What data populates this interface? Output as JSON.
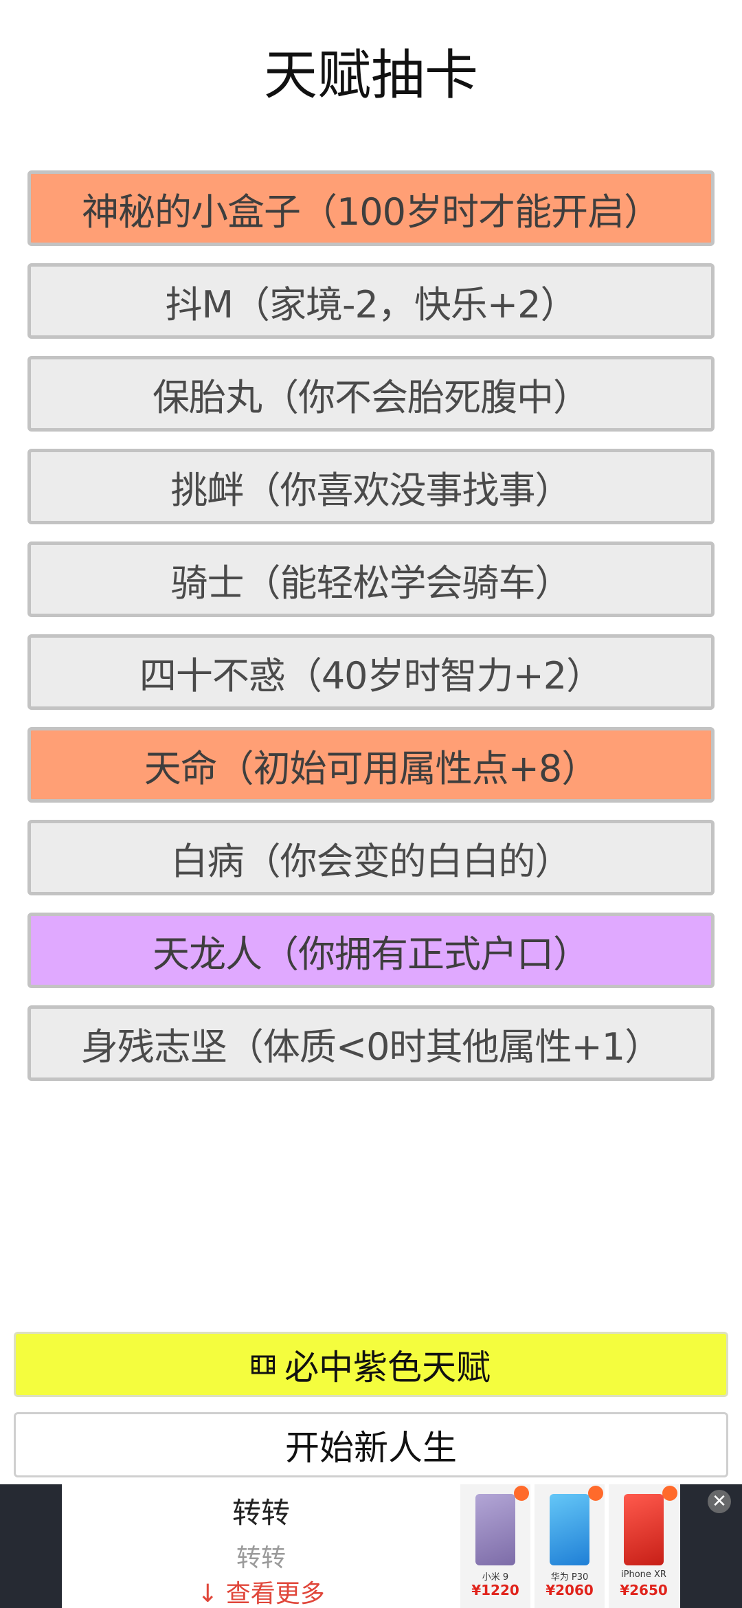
{
  "title": "天赋抽卡",
  "talents": [
    {
      "label": "神秘的小盒子（100岁时才能开启）",
      "color": "#ff9f75"
    },
    {
      "label": "抖M（家境-2，快乐+2）",
      "color": "#ececec"
    },
    {
      "label": "保胎丸（你不会胎死腹中）",
      "color": "#ececec"
    },
    {
      "label": "挑衅（你喜欢没事找事）",
      "color": "#ececec"
    },
    {
      "label": "骑士（能轻松学会骑车）",
      "color": "#ececec"
    },
    {
      "label": "四十不惑（40岁时智力+2）",
      "color": "#ececec"
    },
    {
      "label": "天命（初始可用属性点+8）",
      "color": "#ff9f75"
    },
    {
      "label": "白病（你会变的白白的）",
      "color": "#ececec"
    },
    {
      "label": "天龙人（你拥有正式户口）",
      "color": "#e0a9ff"
    },
    {
      "label": "身残志坚（体质<0时其他属性+1）",
      "color": "#ececec"
    }
  ],
  "buttons": {
    "guarantee_purple": "必中紫色天赋",
    "guarantee_icon": "film-icon",
    "start_new_life": "开始新人生"
  },
  "ad": {
    "title": "转转",
    "subtitle": "转转",
    "more": "↓ 查看更多",
    "close_icon": "close-icon",
    "products": [
      {
        "name": "小米 9",
        "price": "¥1220",
        "color": "#8d7db1"
      },
      {
        "name": "华为 P30",
        "price": "¥2060",
        "color": "#3aa8e8"
      },
      {
        "name": "iPhone XR",
        "price": "¥2650",
        "color": "#e8352b"
      }
    ]
  }
}
